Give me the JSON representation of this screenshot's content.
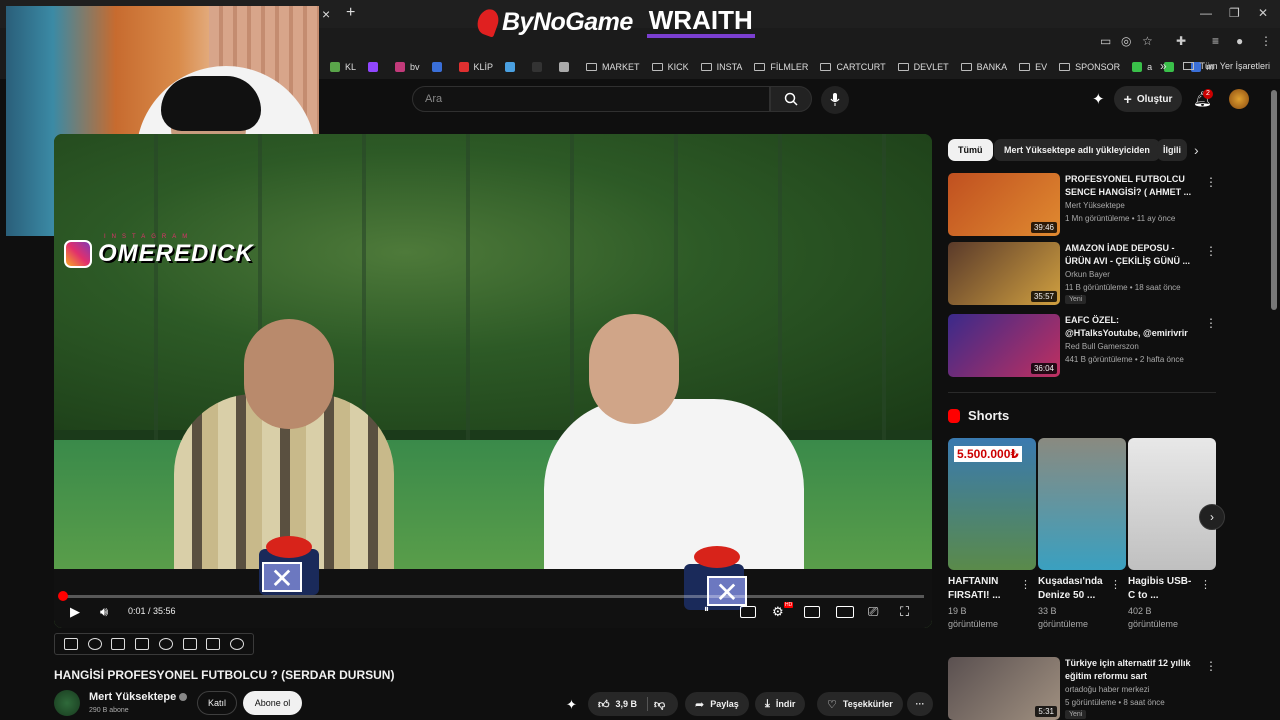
{
  "browser": {
    "tab_close": "×",
    "tab_new": "+",
    "bookmarks": [
      {
        "label": "KL",
        "color": "#5aa54a"
      },
      {
        "label": "",
        "color": "#9146ff"
      },
      {
        "label": "bv",
        "color": "#c23a7a"
      },
      {
        "label": "",
        "color": "#3a6fd8"
      },
      {
        "label": "KLİP",
        "color": "#e03030"
      },
      {
        "label": "",
        "color": "#4aa0e0"
      },
      {
        "label": "",
        "color": "#333333"
      },
      {
        "label": "",
        "color": "#aaaaaa"
      }
    ],
    "folders": [
      "MARKET",
      "KICK",
      "INSTA",
      "FİLMLER",
      "CARTCURT",
      "DEVLET",
      "BANKA",
      "EV",
      "SPONSOR"
    ],
    "tail_bookmarks": [
      {
        "label": "a",
        "color": "#3ac04a"
      },
      {
        "label": "",
        "color": "#3ac04a"
      },
      {
        "label": "m",
        "color": "#3a6fd8"
      }
    ],
    "more_bookmarks": "»",
    "all_bookmarks": "Tüm Yer İşaretleri"
  },
  "brand": {
    "logo": "ByNoGame",
    "partner": "WRAITH"
  },
  "overlay": {
    "insta_handle": "OMEREDICK",
    "insta_sub": "INSTAGRAM"
  },
  "header": {
    "search_placeholder": "Ara",
    "create_label": "Oluştur",
    "notification_count": "2"
  },
  "player": {
    "current_time": "0:01",
    "duration": "35:56",
    "time_display": "0:01 / 35:56",
    "progress_fraction": 0.0005,
    "hd_badge": "HD"
  },
  "video": {
    "title": "HANGİSİ PROFESYONEL FUTBOLCU ? (SERDAR DURSUN)",
    "channel": "Mert Yüksektepe",
    "subscribers": "290 B abone",
    "join_label": "Katıl",
    "subscribe_label": "Abone ol",
    "likes": "3,9 B",
    "share_label": "Paylaş",
    "download_label": "İndir",
    "thanks_label": "Teşekkürler",
    "more": "···"
  },
  "chips": [
    "Tümü",
    "Mert Yüksektepe adlı yükleyiciden",
    "İlgili"
  ],
  "recommendations": [
    {
      "title": "PROFESYONEL FUTBOLCU SENCE HANGİSİ? ( AHMET ...",
      "channel": "Mert Yüksektepe",
      "meta": "1 Mn görüntüleme • 11 ay önce",
      "duration": "39:46",
      "new": "",
      "thumb": [
        "#c05020",
        "#e08a30"
      ]
    },
    {
      "title": "AMAZON İADE DEPOSU - ÜRÜN AVI - ÇEKİLİŞ GÜNÜ ...",
      "channel": "Orkun Bayer",
      "meta": "11 B görüntüleme • 18 saat önce",
      "duration": "35:57",
      "new": "Yeni",
      "thumb": [
        "#5a3a2a",
        "#d0a040"
      ]
    },
    {
      "title": "EAFC ÖZEL: @HTalksYoutube, @emirivrir VS @EgeArseven, ...",
      "channel": "Red Bull Gamerszon",
      "meta": "441 B görüntüleme • 2 hafta önce",
      "duration": "36:04",
      "new": "",
      "thumb": [
        "#3a2a8a",
        "#c03060"
      ]
    },
    {
      "title": "Türkiye için alternatif 12 yıllık eğitim reformu sart",
      "channel": "ortadoğu haber merkezi",
      "meta": "5 görüntüleme • 8 saat önce",
      "duration": "5:31",
      "new": "Yeni",
      "thumb": [
        "#5a5050",
        "#a09080"
      ]
    }
  ],
  "shorts": {
    "heading": "Shorts",
    "items": [
      {
        "title": "HAFTANIN FIRSATI! ...",
        "views": "19 B görüntüleme",
        "thumb": [
          "#3a7ab0",
          "#5a8a4a"
        ],
        "badge": "5.500.000₺"
      },
      {
        "title": "Kuşadası'nda Denize 50 ...",
        "views": "33 B görüntüleme",
        "thumb": [
          "#8a8a80",
          "#3aa0c0"
        ],
        "badge": ""
      },
      {
        "title": "Hagibis USB-C to ...",
        "views": "402 B görüntüleme",
        "thumb": [
          "#e8e8e8",
          "#c0c0c0"
        ],
        "badge": ""
      }
    ]
  }
}
